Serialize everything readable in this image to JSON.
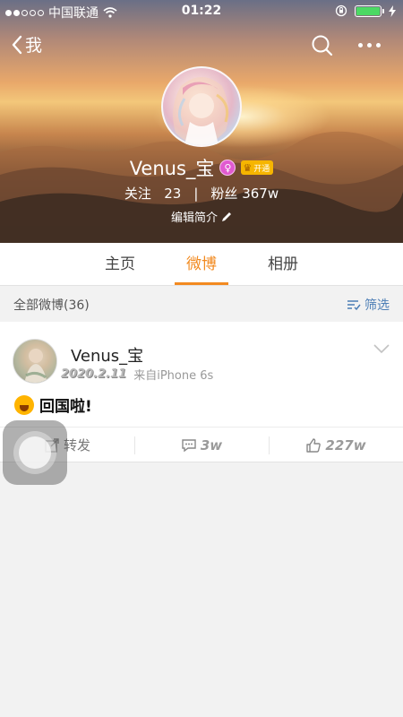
{
  "status_bar": {
    "carrier": "中国联通",
    "time": "01:22",
    "battery_color": "#4cd964"
  },
  "nav": {
    "back_label": "我",
    "icons": [
      "chevron-left-icon",
      "search-icon",
      "more-icon"
    ]
  },
  "profile": {
    "name": "Venus_宝",
    "verified_symbol": "♀",
    "vip_label": "开通",
    "follow_label": "关注",
    "follow_count": "23",
    "separator": "|",
    "fans_label": "粉丝",
    "fans_count": "367w",
    "bio_label": "编辑简介"
  },
  "tabs": [
    {
      "label": "主页",
      "active": false
    },
    {
      "label": "微博",
      "active": true
    },
    {
      "label": "相册",
      "active": false
    }
  ],
  "filter_bar": {
    "all_posts_label": "全部微博(36)",
    "filter_label": "筛选"
  },
  "post": {
    "author": "Venus_宝",
    "date": "2020.2.11",
    "source": "来自iPhone 6s",
    "text": "回国啦!",
    "repost_label": "转发",
    "comment_count": "3w",
    "like_count": "227w"
  },
  "colors": {
    "accent": "#f28a20",
    "link": "#4b7db5"
  }
}
